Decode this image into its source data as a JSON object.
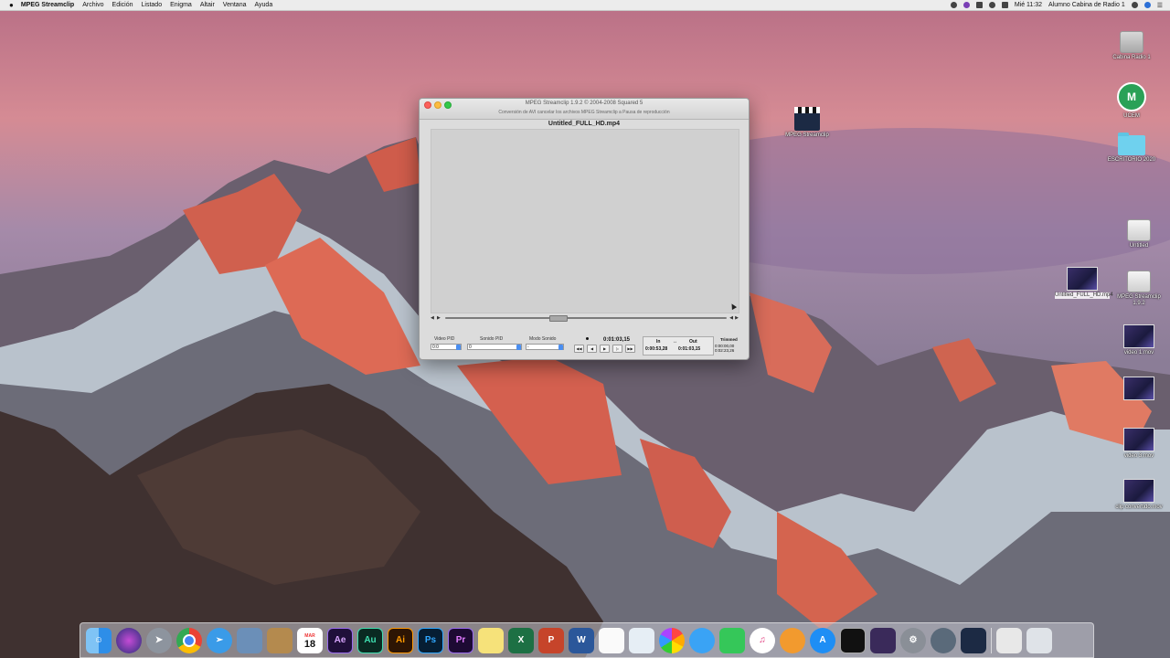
{
  "menubar": {
    "apple": "",
    "app_name": "MPEG Streamclip",
    "menus": [
      "Archivo",
      "Edición",
      "Listado",
      "Enigma",
      "Altair",
      "Ventana",
      "Ayuda"
    ],
    "clock": "Mié 11:32",
    "user": "Alumno Cabina de Radio 1"
  },
  "window": {
    "title": "MPEG Streamclip 1.9.2 © 2004-2008 Squared 5",
    "subtitle": "Conversión de AVI cancelar los archivos MPEG Streamclip a Pausa de reproducción",
    "filename": "Untitled_FULL_HD.mp4",
    "controls": {
      "video_pid_label": "Video PID",
      "video_pid_value": "0:0",
      "sound_pid_label": "Sonido PID",
      "sound_pid_value": "0",
      "sound_mode_label": "Modo Sonido",
      "sound_mode_value": "-",
      "timecode": "0:01:03,15",
      "in_label": "In",
      "out_label": "Out",
      "in_value": "0:00:53,28",
      "out_value": "0:01:03,15",
      "trimmed_label": "Trimmed",
      "trimmed_value_1": "0:00:00,00",
      "trimmed_value_2": "0:02:23,26"
    }
  },
  "desktop_icons": {
    "mpeg_streamclip": "MPEG Streamclip",
    "cabina": "Cabina Radio 1",
    "ucem": "UCEM",
    "escritorio": "ESCRITORIO 2020",
    "untitled_drive": "Untitled",
    "untitled_video": "Untitled_FULL_HD.mp4",
    "mpeg_disk": "MPEG Streamclip 1.9.2",
    "video1": "video 1.mov",
    "video3": "video 3.mov",
    "clip": "clip convertido.mov"
  },
  "dock": {
    "calendar_day": "18",
    "calendar_month": "MAR",
    "apps": [
      "Finder",
      "Siri",
      "Launchpad",
      "Chrome",
      "Safari",
      "Preview",
      "Notes",
      "Calendar",
      "Ae",
      "Au",
      "Ai",
      "Ps",
      "Pr",
      "Stickies",
      "Excel",
      "PowerPoint",
      "Word",
      "TextEdit",
      "Mail",
      "Photos",
      "Messages",
      "FaceTime",
      "iTunes",
      "iBooks",
      "App Store",
      "Final Cut",
      "Compressor",
      "System Preferences",
      "QuickTime",
      "MPEG Streamclip",
      "Downloads",
      "Trash"
    ]
  }
}
